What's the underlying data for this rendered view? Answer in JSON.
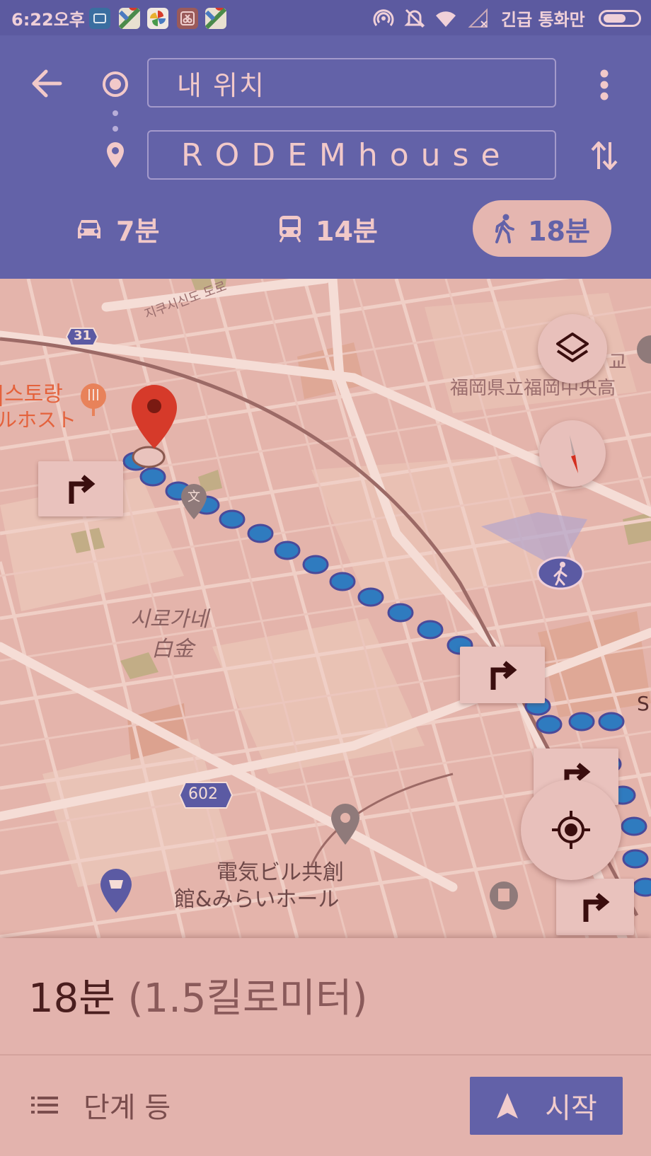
{
  "status_bar": {
    "time": "6:22오후",
    "notification_icons": [
      "mi-home-icon",
      "google-maps-icon",
      "pinwheel-icon",
      "scissors-app-icon",
      "google-maps-icon"
    ],
    "status_icons": [
      "hotspot-icon",
      "mute-icon",
      "wifi-icon",
      "no-signal-icon"
    ],
    "emergency_text": "긴급 통화만",
    "battery_level": 0.65
  },
  "directions": {
    "origin": "내 위치",
    "destination": "RODEMhouse",
    "modes": [
      {
        "name": "drive",
        "time": "7분",
        "icon": "car-icon",
        "selected": false
      },
      {
        "name": "transit",
        "time": "14분",
        "icon": "train-icon",
        "selected": false
      },
      {
        "name": "walk",
        "time": "18분",
        "icon": "walk-icon",
        "selected": true
      }
    ]
  },
  "map": {
    "road_labels": {
      "upper_road": "지쿠시신도 도로",
      "route_31": "31",
      "route_602": "602"
    },
    "area_label": {
      "korean": "시로가네",
      "japanese": "白金"
    },
    "poi": {
      "restaurant_kr": "|스토랑",
      "restaurant_jp": "ルホスト",
      "school_kr": "교",
      "school_jp": "福岡県立福岡中央高",
      "building_jp_line1": "電気ビル共創",
      "building_jp_line2": "館&みらいホール",
      "edge_letter": "S"
    }
  },
  "route": {
    "summary_time": "18분",
    "summary_distance": "(1.5킬로미터)"
  },
  "actions": {
    "steps_label": "단계 등",
    "start_label": "시작"
  },
  "colors": {
    "header": "#6362a8",
    "status_bar": "#5c5aa0",
    "route_dot": "#2f7bbf",
    "pin": "#d63a2a",
    "map_background": "#e4b4ab",
    "sheet": "#e3b3ad"
  }
}
